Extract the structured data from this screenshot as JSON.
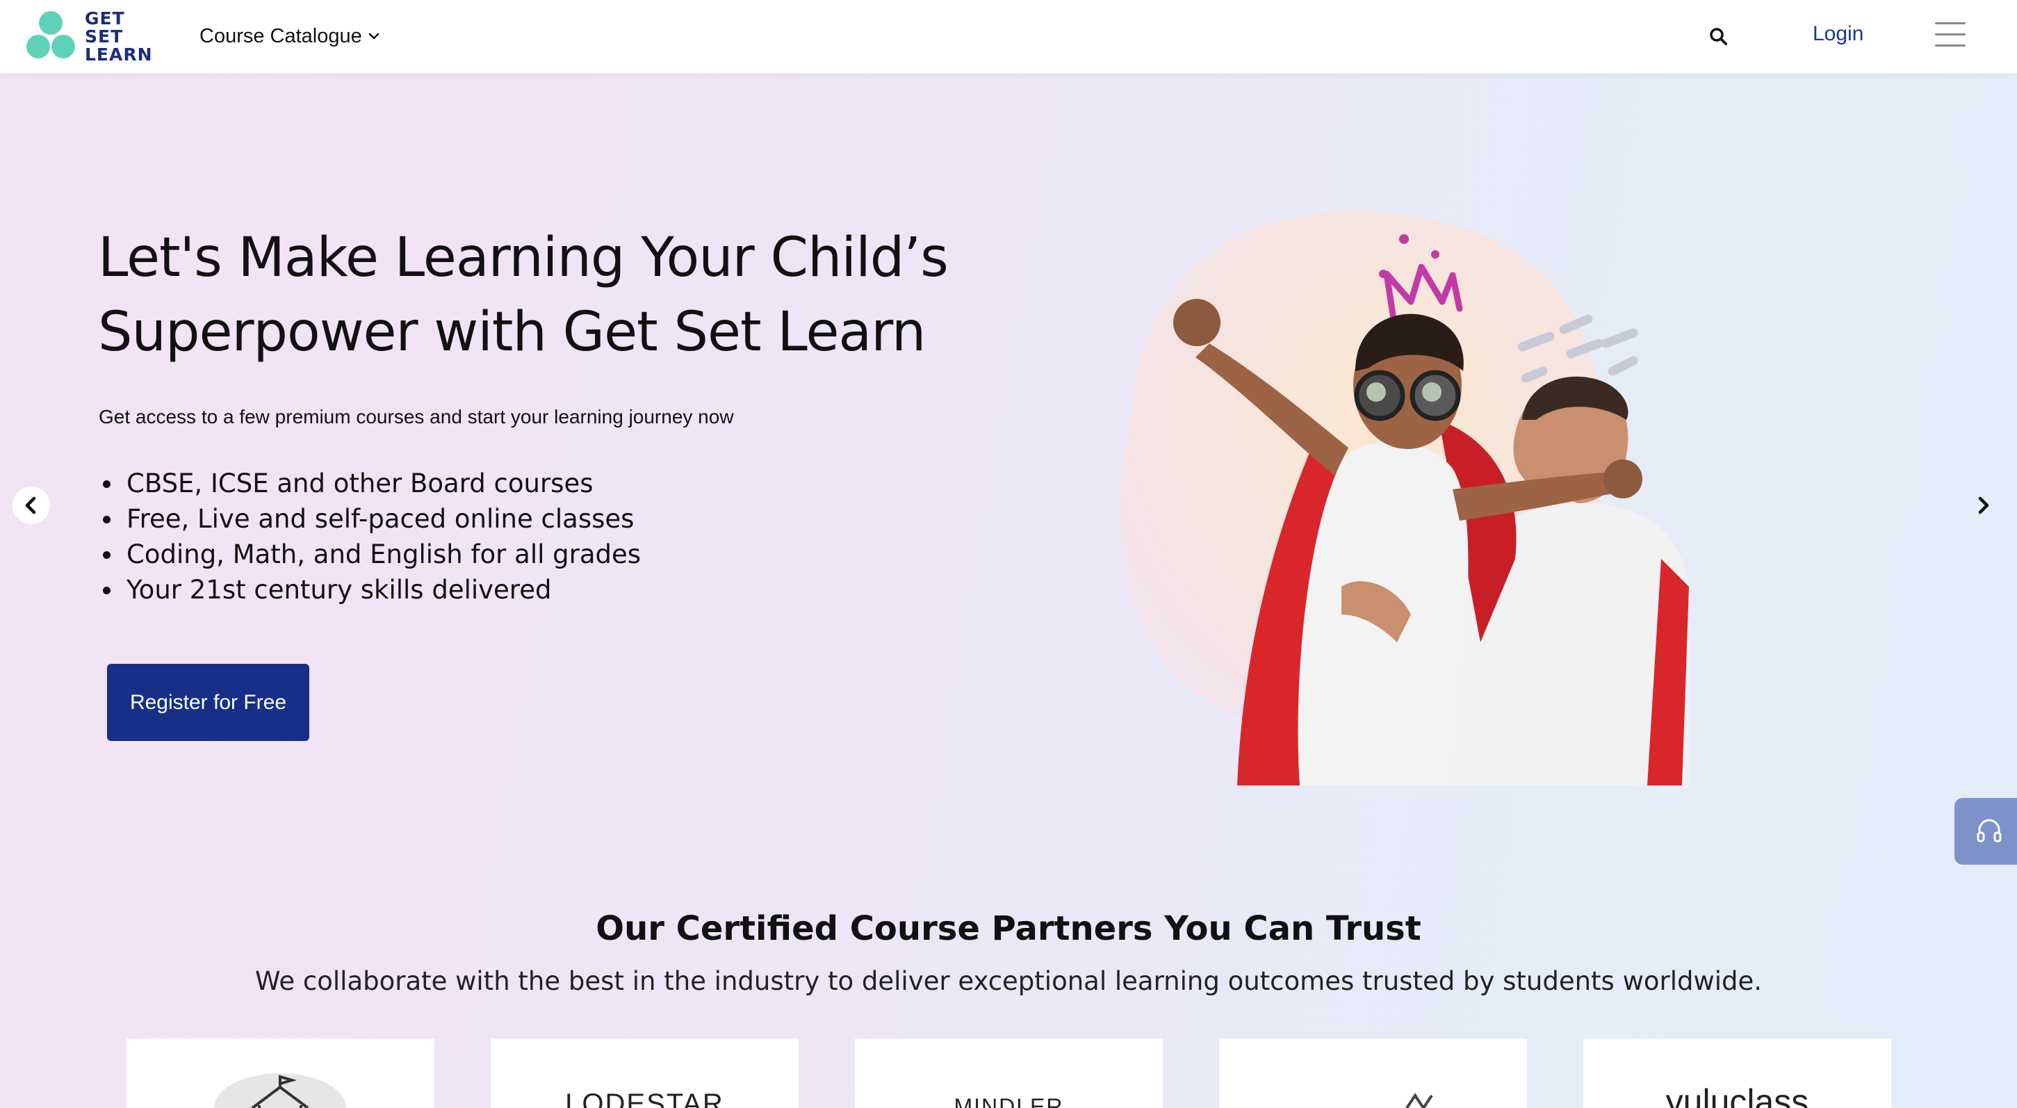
{
  "brand": {
    "logo_lines": [
      "GET",
      "SET",
      "LEARN"
    ],
    "accent": "#5ed3b9",
    "primary": "#1c2d7c"
  },
  "header": {
    "catalogue_label": "Course Catalogue",
    "login_label": "Login",
    "icons": [
      "search-icon",
      "hamburger-menu-icon",
      "chevron-down-icon"
    ]
  },
  "hero": {
    "title_line1": "Let's Make Learning Your Child’s",
    "title_line2": "Superpower with Get Set Learn",
    "subtitle": "Get access to a few premium courses and start your learning journey now",
    "bullets": [
      "CBSE, ICSE and other Board courses",
      "Free, Live and self-paced online classes",
      "Coding, Math, and English for all grades",
      "Your 21st century skills delivered"
    ],
    "cta_label": "Register for Free",
    "cta_color": "#172f88",
    "carousel_icons": [
      "chevron-left-icon",
      "chevron-right-icon"
    ]
  },
  "support": {
    "icon": "headset-icon",
    "color": "#7d92c9"
  },
  "partners": {
    "title": "Our Certified Course Partners You Can Trust",
    "subtitle": "We collaborate with the best in the industry to deliver exceptional learning outcomes trusted by students worldwide.",
    "logos": [
      "",
      "LODESTAR",
      "MINDLER",
      "",
      "yuluclass"
    ]
  }
}
